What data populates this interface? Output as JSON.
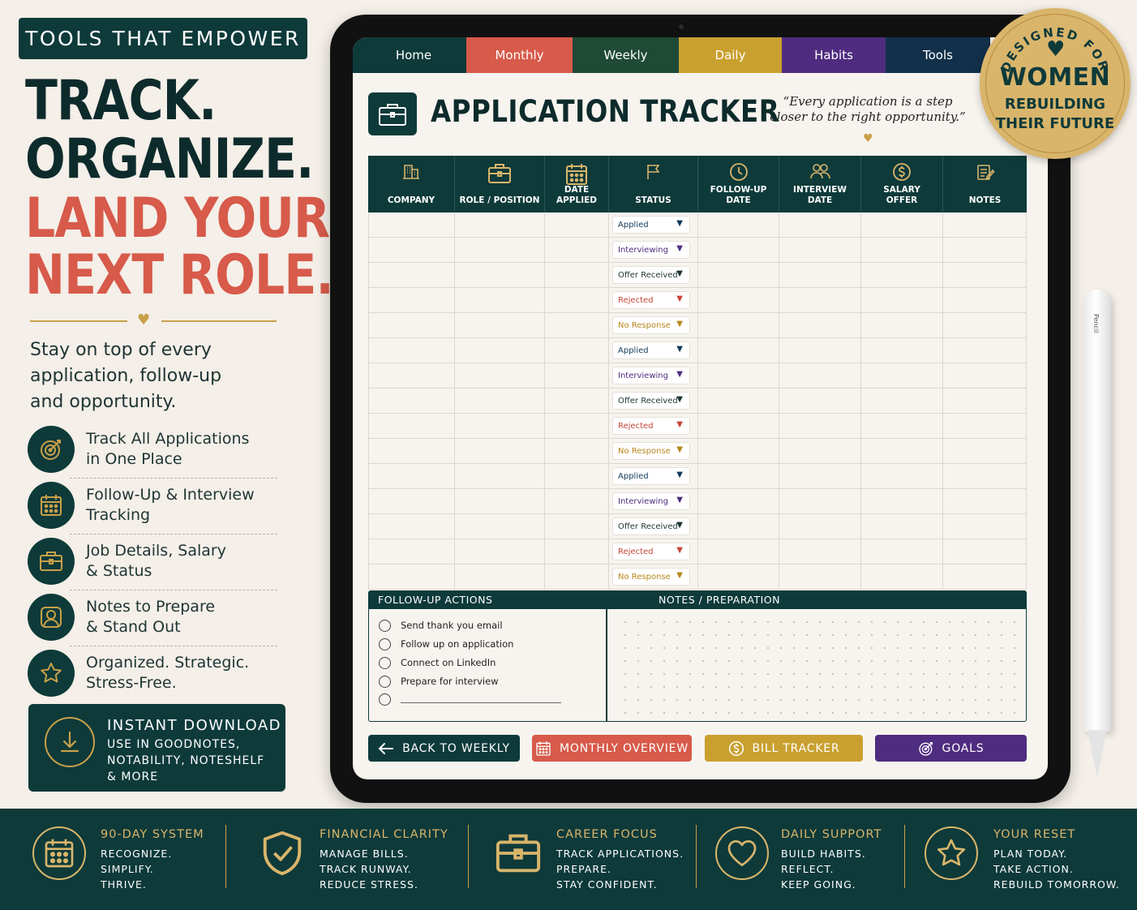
{
  "left_panel": {
    "badge": "TOOLS THAT EMPOWER",
    "headline": [
      "TRACK.",
      "ORGANIZE.",
      "LAND YOUR",
      "NEXT ROLE."
    ],
    "intro": [
      "Stay on top of every",
      "application, follow-up",
      "and opportunity."
    ],
    "features": [
      {
        "icon": "target-icon",
        "lines": [
          "Track All Applications",
          "in One Place"
        ]
      },
      {
        "icon": "calendar-icon",
        "lines": [
          "Follow-Up & Interview",
          "Tracking"
        ]
      },
      {
        "icon": "briefcase-icon",
        "lines": [
          "Job Details, Salary",
          "& Status"
        ]
      },
      {
        "icon": "person-icon",
        "lines": [
          "Notes to Prepare",
          "& Stand Out"
        ]
      },
      {
        "icon": "star-icon",
        "lines": [
          "Organized. Strategic.",
          "Stress-Free."
        ]
      }
    ],
    "download": {
      "title": "INSTANT DOWNLOAD",
      "lines": [
        "USE IN GOODNOTES,",
        "NOTABILITY, NOTESHELF",
        "& MORE"
      ]
    }
  },
  "tabs": [
    {
      "label": "Home",
      "color": "#0e3a3a"
    },
    {
      "label": "Monthly",
      "color": "#d75a4a"
    },
    {
      "label": "Weekly",
      "color": "#1f4a36"
    },
    {
      "label": "Daily",
      "color": "#c9a02f"
    },
    {
      "label": "Habits",
      "color": "#4f2c7f"
    },
    {
      "label": "Tools",
      "color": "#12304a"
    }
  ],
  "page": {
    "title": "APPLICATION TRACKER",
    "quote": [
      "“Every application is a step",
      "closer to the right opportunity.”"
    ]
  },
  "table": {
    "columns": [
      {
        "icon": "building-icon",
        "lines": [
          "COMPANY"
        ]
      },
      {
        "icon": "briefcase-icon",
        "lines": [
          "ROLE / POSITION"
        ]
      },
      {
        "icon": "calendar-icon",
        "lines": [
          "DATE",
          "APPLIED"
        ]
      },
      {
        "icon": "flag-icon",
        "lines": [
          "STATUS"
        ]
      },
      {
        "icon": "clock-icon",
        "lines": [
          "FOLLOW-UP",
          "DATE"
        ]
      },
      {
        "icon": "people-icon",
        "lines": [
          "INTERVIEW",
          "DATE"
        ]
      },
      {
        "icon": "dollar-icon",
        "lines": [
          "SALARY",
          "OFFER"
        ]
      },
      {
        "icon": "notes-icon",
        "lines": [
          "NOTES"
        ]
      }
    ],
    "statuses": [
      "Applied",
      "Interviewing",
      "Offer Received",
      "Rejected",
      "No Response",
      "Applied",
      "Interviewing",
      "Offer Received",
      "Rejected",
      "No Response",
      "Applied",
      "Interviewing",
      "Offer Received",
      "Rejected",
      "No Response"
    ],
    "status_colors": {
      "Applied": "#123a5a",
      "Interviewing": "#4f2c7f",
      "Offer Received": "#1e3434",
      "Rejected": "#c8463a",
      "No Response": "#b8861c"
    }
  },
  "followup": {
    "header": "FOLLOW-UP ACTIONS",
    "items": [
      "Send thank you email",
      "Follow up on application",
      "Connect on LinkedIn",
      "Prepare for interview"
    ]
  },
  "notes": {
    "header": "NOTES / PREPARATION"
  },
  "buttons": [
    {
      "label": "BACK TO WEEKLY",
      "icon": "arrow-left-icon",
      "color": "#0e3a3a"
    },
    {
      "label": "MONTHLY OVERVIEW",
      "icon": "calendar-icon",
      "color": "#d75a4a"
    },
    {
      "label": "BILL TRACKER",
      "icon": "dollar-icon",
      "color": "#c9a02f"
    },
    {
      "label": "GOALS",
      "icon": "target-icon",
      "color": "#4f2c7f"
    }
  ],
  "seal": {
    "top": "DESIGNED FOR",
    "main": "WOMEN",
    "sub": [
      "REBUILDING",
      "THEIR FUTURE"
    ]
  },
  "pencil": {
    "label": "Pencil"
  },
  "band": [
    {
      "icon": "calendar-icon",
      "title": "90-DAY SYSTEM",
      "lines": [
        "RECOGNIZE.",
        "SIMPLIFY.",
        "THRIVE."
      ]
    },
    {
      "icon": "shield-icon",
      "title": "FINANCIAL CLARITY",
      "lines": [
        "MANAGE BILLS.",
        "TRACK RUNWAY.",
        "REDUCE STRESS."
      ]
    },
    {
      "icon": "briefcase-icon",
      "title": "CAREER FOCUS",
      "lines": [
        "TRACK APPLICATIONS.",
        "PREPARE.",
        "STAY CONFIDENT."
      ]
    },
    {
      "icon": "heart-icon",
      "title": "DAILY SUPPORT",
      "lines": [
        "BUILD HABITS.",
        "REFLECT.",
        "KEEP GOING."
      ]
    },
    {
      "icon": "star-icon",
      "title": "YOUR RESET",
      "lines": [
        "PLAN TODAY.",
        "TAKE ACTION.",
        "REBUILD TOMORROW."
      ]
    }
  ]
}
